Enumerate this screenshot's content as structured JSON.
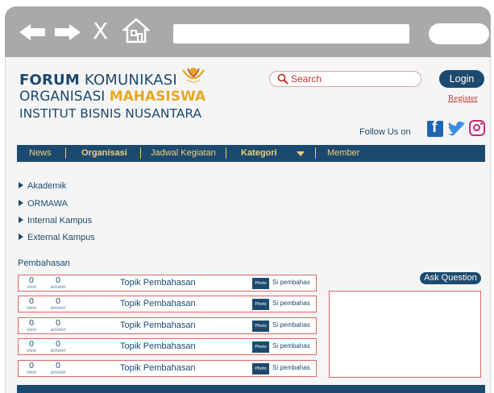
{
  "browser": {
    "back_icon": "left-arrow-icon",
    "forward_icon": "right-arrow-icon",
    "close_label": "X",
    "home_icon": "home-icon",
    "address_value": ""
  },
  "logo": {
    "line1_bold": "FORUM",
    "line1_rest": "KOMUNIKASI",
    "line2_regular": "ORGANISASI",
    "line2_accent": "MAHASISWA",
    "line3": "INSTITUT BISNIS NUSANTARA"
  },
  "search": {
    "placeholder": "Search"
  },
  "auth": {
    "login_label": "Login",
    "register_label": "Register"
  },
  "social": {
    "follow_label": "Follow Us on",
    "icons": [
      "facebook-icon",
      "twitter-icon",
      "instagram-icon"
    ]
  },
  "nav": {
    "items": [
      "News",
      "Organisasi",
      "Jadwal Kegiatan",
      "Kategori",
      "Member"
    ]
  },
  "categories": [
    "Akademik",
    "ORMAWA",
    "Internal Kampus",
    "External Kampus"
  ],
  "discussion": {
    "heading": "Pembahasan",
    "view_label": "view",
    "answer_label": "answer",
    "rows": [
      {
        "views": "0",
        "answers": "0",
        "topic": "Topik Pembahasan",
        "photo": "Photo",
        "author": "Si pembahas"
      },
      {
        "views": "0",
        "answers": "0",
        "topic": "Topik Pembahasan",
        "photo": "Photo",
        "author": "Si pembahas"
      },
      {
        "views": "0",
        "answers": "0",
        "topic": "Topik Pembahasan",
        "photo": "Photo",
        "author": "Si pembahas"
      },
      {
        "views": "0",
        "answers": "0",
        "topic": "Topik Pembahasan",
        "photo": "Photo",
        "author": "Si pembahas"
      },
      {
        "views": "0",
        "answers": "0",
        "topic": "Topik Pembahasan",
        "photo": "Photo",
        "author": "Si pembahas"
      }
    ]
  },
  "ask_label": "Ask Question",
  "colors": {
    "primary": "#1c4a6e",
    "accent": "#e5a920",
    "alert": "#c0392b",
    "chrome": "#a9a9a9"
  }
}
